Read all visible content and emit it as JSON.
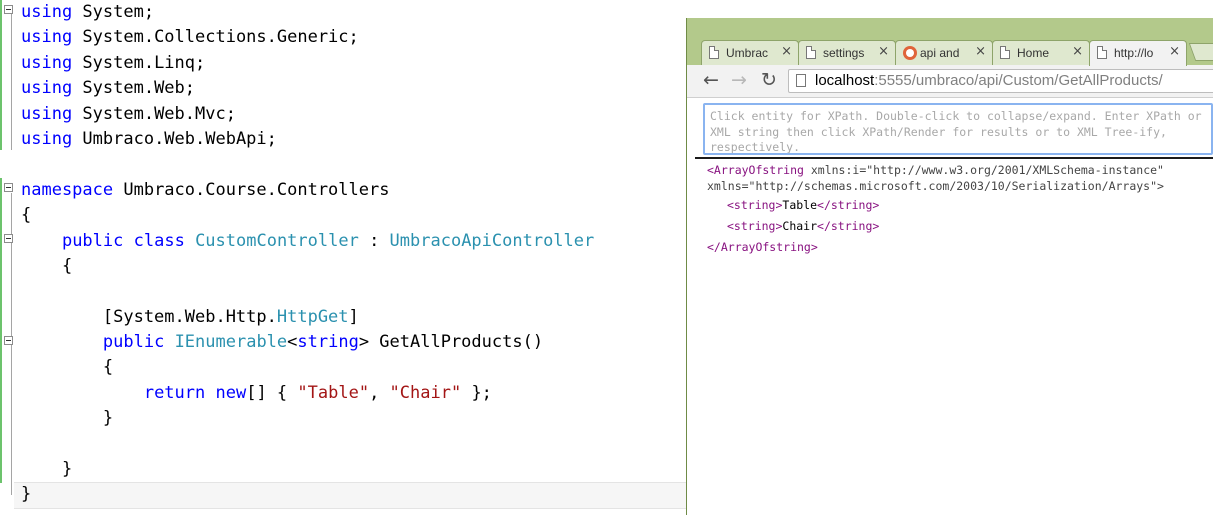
{
  "editor": {
    "lines": [
      [
        {
          "t": "kw",
          "v": "using"
        },
        {
          "t": "tx",
          "v": " System;"
        }
      ],
      [
        {
          "t": "kw",
          "v": "using"
        },
        {
          "t": "tx",
          "v": " System.Collections.Generic;"
        }
      ],
      [
        {
          "t": "kw",
          "v": "using"
        },
        {
          "t": "tx",
          "v": " System.Linq;"
        }
      ],
      [
        {
          "t": "kw",
          "v": "using"
        },
        {
          "t": "tx",
          "v": " System.Web;"
        }
      ],
      [
        {
          "t": "kw",
          "v": "using"
        },
        {
          "t": "tx",
          "v": " System.Web.Mvc;"
        }
      ],
      [
        {
          "t": "kw",
          "v": "using"
        },
        {
          "t": "tx",
          "v": " Umbraco.Web.WebApi;"
        }
      ],
      [],
      [
        {
          "t": "kw",
          "v": "namespace"
        },
        {
          "t": "tx",
          "v": " Umbraco.Course.Controllers"
        }
      ],
      [
        {
          "t": "tx",
          "v": "{"
        }
      ],
      [
        {
          "t": "tx",
          "v": "    "
        },
        {
          "t": "kw",
          "v": "public"
        },
        {
          "t": "tx",
          "v": " "
        },
        {
          "t": "kw",
          "v": "class"
        },
        {
          "t": "tx",
          "v": " "
        },
        {
          "t": "ty",
          "v": "CustomController"
        },
        {
          "t": "tx",
          "v": " : "
        },
        {
          "t": "ty",
          "v": "UmbracoApiController"
        }
      ],
      [
        {
          "t": "tx",
          "v": "    {"
        }
      ],
      [],
      [
        {
          "t": "tx",
          "v": "        [System.Web.Http."
        },
        {
          "t": "ty",
          "v": "HttpGet"
        },
        {
          "t": "tx",
          "v": "]"
        }
      ],
      [
        {
          "t": "tx",
          "v": "        "
        },
        {
          "t": "kw",
          "v": "public"
        },
        {
          "t": "tx",
          "v": " "
        },
        {
          "t": "ty",
          "v": "IEnumerable"
        },
        {
          "t": "tx",
          "v": "<"
        },
        {
          "t": "kw",
          "v": "string"
        },
        {
          "t": "tx",
          "v": "> GetAllProducts()"
        }
      ],
      [
        {
          "t": "tx",
          "v": "        {"
        }
      ],
      [
        {
          "t": "tx",
          "v": "            "
        },
        {
          "t": "kw",
          "v": "return"
        },
        {
          "t": "tx",
          "v": " "
        },
        {
          "t": "kw",
          "v": "new"
        },
        {
          "t": "tx",
          "v": "[] { "
        },
        {
          "t": "st",
          "v": "\"Table\""
        },
        {
          "t": "tx",
          "v": ", "
        },
        {
          "t": "st",
          "v": "\"Chair\""
        },
        {
          "t": "tx",
          "v": " };"
        }
      ],
      [
        {
          "t": "tx",
          "v": "        }"
        }
      ],
      [],
      [
        {
          "t": "tx",
          "v": "    }"
        }
      ],
      [
        {
          "t": "tx",
          "v": "}"
        }
      ]
    ]
  },
  "browser": {
    "tabs": [
      {
        "label": "Umbrac",
        "icon": "page-icon",
        "active": false
      },
      {
        "label": "settings",
        "icon": "page-icon",
        "active": false
      },
      {
        "label": "api and",
        "icon": "duckduckgo-icon",
        "active": false
      },
      {
        "label": "Home",
        "icon": "page-icon",
        "active": false
      },
      {
        "label": "http://lo",
        "icon": "page-icon",
        "active": true
      }
    ],
    "tab_close": "×",
    "nav": {
      "back": "←",
      "forward": "→",
      "reload": "↻"
    },
    "url": {
      "host": "localhost",
      "rest": ":5555/umbraco/api/Custom/GetAllProducts/"
    },
    "xpath_placeholder": "Click entity for XPath. Double-click to collapse/expand. Enter XPath or XML string then click XPath/Render for results or to XML Tree-ify, respectively.",
    "xml": {
      "root_open_tag": "<ArrayOfstring",
      "root_ns1": " xmlns:i=\"http://www.w3.org/2001/XMLSchema-instance\"",
      "root_ns2": "xmlns=\"http://schemas.microsoft.com/2003/10/Serialization/Arrays\">",
      "item_open": "<string>",
      "item_close": "</string>",
      "items": [
        "Table",
        "Chair"
      ],
      "root_close_tag": "</ArrayOfstring>"
    }
  }
}
